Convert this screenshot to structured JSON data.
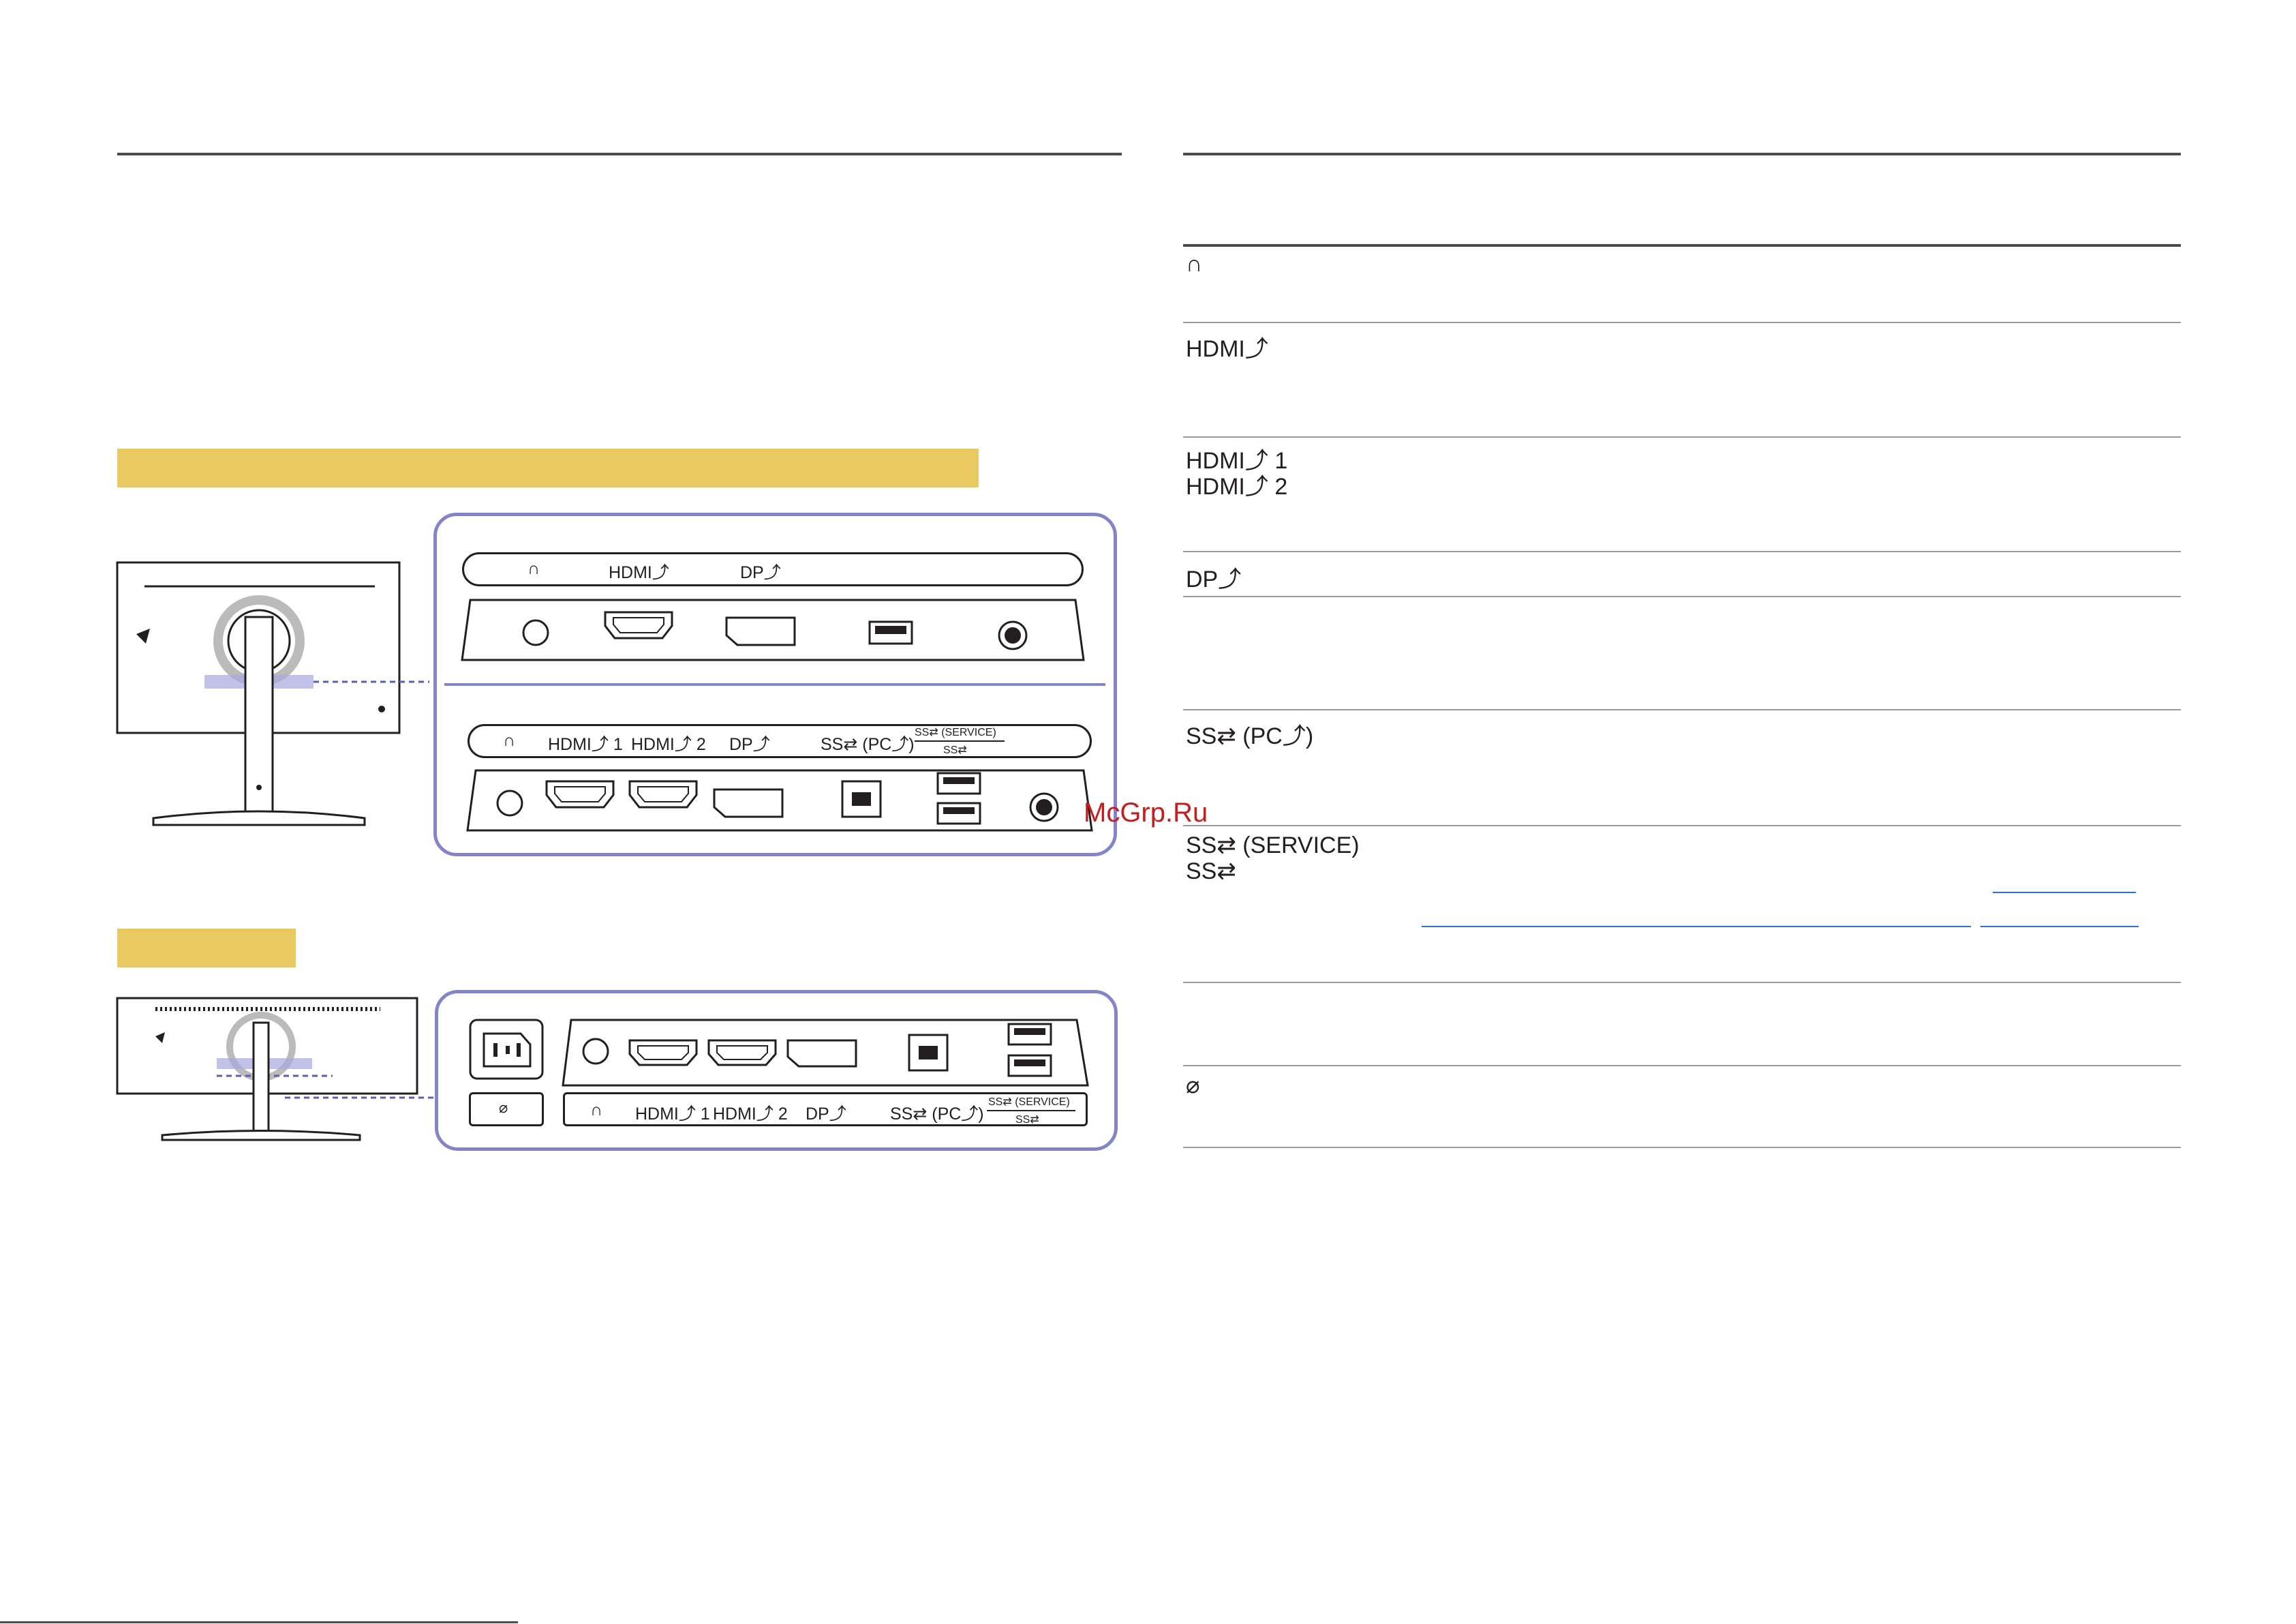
{
  "left": {
    "top_panel": {
      "labels": {
        "headphone": "∩",
        "hdmi": "HDMI⤴",
        "dp": "DP⤴"
      }
    },
    "bottom_panel": {
      "labels": {
        "headphone": "∩",
        "hdmi1": "HDMI⤴ 1",
        "hdmi2": "HDMI⤴ 2",
        "dp": "DP⤴",
        "usb_pc": "SS⇄ (PC⤴)",
        "usb_service": "SS⇄ (SERVICE)",
        "usb_ss": "SS⇄"
      }
    },
    "second_model_panel": {
      "labels": {
        "headphone": "∩",
        "hdmi1": "HDMI⤴ 1",
        "hdmi2": "HDMI⤴ 2",
        "dp": "DP⤴",
        "usb_pc": "SS⇄ (PC⤴)",
        "usb_service": "SS⇄ (SERVICE)",
        "usb_ss": "SS⇄",
        "power": "⌀"
      }
    }
  },
  "right_table": {
    "rows": [
      {
        "port": "∩"
      },
      {
        "port": "HDMI⤴"
      },
      {
        "port": "HDMI⤴ 1",
        "port2": "HDMI⤴ 2"
      },
      {
        "port": "DP⤴"
      },
      {
        "port": ""
      },
      {
        "port": "SS⇄ (PC⤴)"
      },
      {
        "port": "SS⇄ (SERVICE)",
        "port2": "SS⇄"
      },
      {
        "port": ""
      },
      {
        "port": "⌀"
      }
    ]
  },
  "watermark": "McGrp.Ru",
  "colors": {
    "banner": "#e8c962",
    "frame": "#8484c8",
    "rule": "#4b4b4d",
    "link": "#2f6fd1",
    "watermark": "#c41e1e"
  }
}
